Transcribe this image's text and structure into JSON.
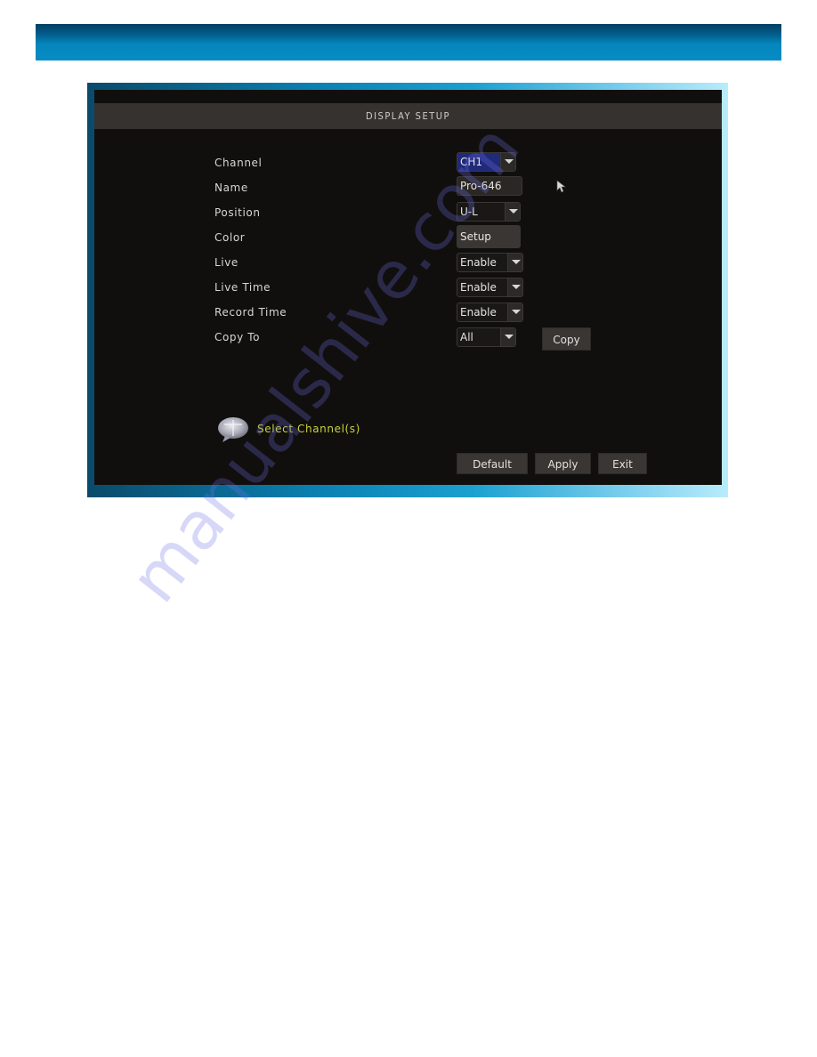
{
  "dialog": {
    "title": "DISPLAY SETUP"
  },
  "fields": [
    {
      "label": "Channel",
      "type": "select",
      "value": "CH1",
      "highlighted": true
    },
    {
      "label": "Name",
      "type": "text",
      "value": "Pro-646"
    },
    {
      "label": "Position",
      "type": "select",
      "value": "U-L"
    },
    {
      "label": "Color",
      "type": "button",
      "value": "Setup"
    },
    {
      "label": "Live",
      "type": "select",
      "value": "Enable"
    },
    {
      "label": "Live Time",
      "type": "select",
      "value": "Enable"
    },
    {
      "label": "Record Time",
      "type": "select",
      "value": "Enable"
    },
    {
      "label": "Copy To",
      "type": "select",
      "value": "All"
    }
  ],
  "copy_button": "Copy",
  "tip": {
    "icon": "speech-bubble-icon",
    "text": "Select Channel(s)"
  },
  "footer_buttons": {
    "default": "Default",
    "apply": "Apply",
    "exit": "Exit"
  },
  "colors": {
    "selected_field": "#1f2a7a",
    "tip_text": "#c8d23c",
    "banner": "#068cc4"
  },
  "watermark": "manualshive.com"
}
